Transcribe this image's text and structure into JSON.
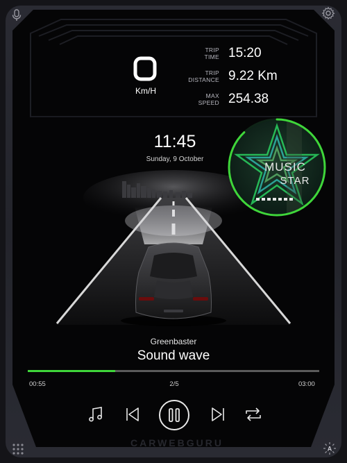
{
  "dashboard": {
    "speed": "0",
    "speed_unit": "Km/H",
    "stats": [
      {
        "label_line1": "TRIP",
        "label_line2": "TIME",
        "value": "15:20"
      },
      {
        "label_line1": "TRIP",
        "label_line2": "DISTANCE",
        "value": "9.22 Km"
      },
      {
        "label_line1": "MAX",
        "label_line2": "SPEED",
        "value": "254.38"
      }
    ]
  },
  "clock": {
    "time": "11:45",
    "date": "Sunday, 9 October"
  },
  "album": {
    "title_line1": "MUSIC",
    "title_line2": "STAR",
    "progress": 0.88
  },
  "player": {
    "artist": "Greenbaster",
    "title": "Sound wave",
    "elapsed": "00:55",
    "total": "03:00",
    "track_position": "2/5",
    "progress": 0.3
  },
  "watermark": "CARWEBGURU",
  "colors": {
    "accent": "#3fd63a",
    "background": "#050506",
    "frame": "#25262d"
  },
  "icons": {
    "top_left": "microphone-icon",
    "top_right": "gear-icon",
    "bottom_left": "app-grid-icon",
    "bottom_right": "auto-brightness-icon",
    "controls": [
      "music-note-icon",
      "skip-previous-icon",
      "pause-icon",
      "skip-next-icon",
      "repeat-icon"
    ]
  }
}
